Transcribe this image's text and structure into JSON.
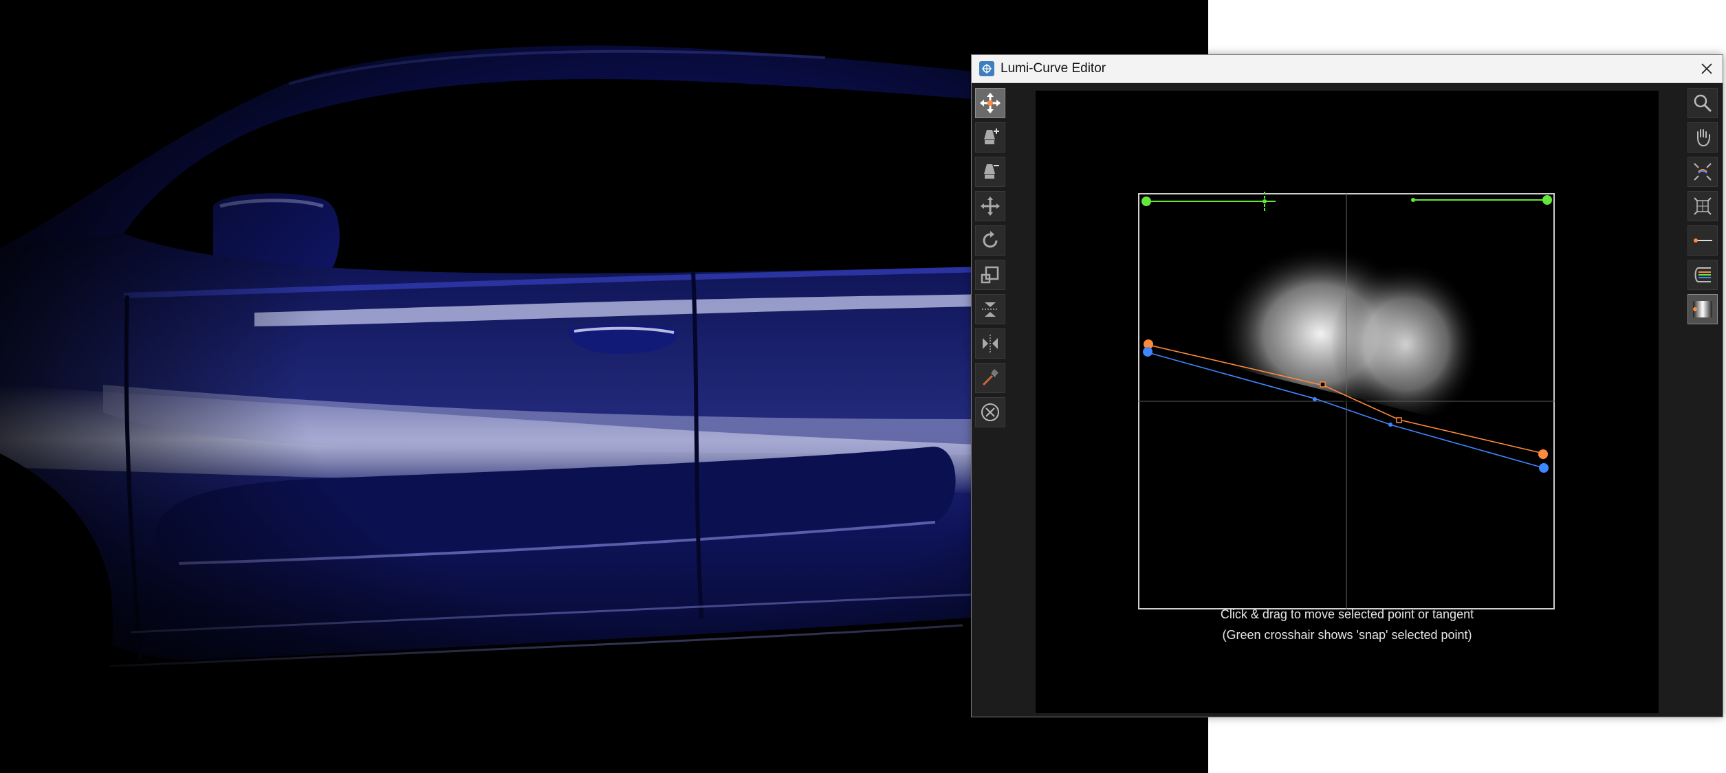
{
  "window": {
    "title": "Lumi-Curve Editor",
    "app_icon": "lumi-curve-app-icon",
    "close_icon": "close-icon"
  },
  "left_toolbar": [
    {
      "name": "move-point-tool",
      "icon": "move-arrows-icon",
      "active": true
    },
    {
      "name": "add-point-tool",
      "icon": "pen-plus-icon",
      "active": false
    },
    {
      "name": "remove-point-tool",
      "icon": "pen-minus-icon",
      "active": false
    },
    {
      "name": "move-all-tool",
      "icon": "move-cross-icon",
      "active": false
    },
    {
      "name": "rotate-tool",
      "icon": "rotate-icon",
      "active": false
    },
    {
      "name": "scale-tool",
      "icon": "scale-box-icon",
      "active": false
    },
    {
      "name": "flip-vertical-tool",
      "icon": "flip-vertical-icon",
      "active": false
    },
    {
      "name": "mirror-horizontal-tool",
      "icon": "mirror-horizontal-icon",
      "active": false
    },
    {
      "name": "eyedropper-tool",
      "icon": "eyedropper-icon",
      "active": false
    },
    {
      "name": "reset-tool",
      "icon": "circle-x-icon",
      "active": false
    }
  ],
  "right_toolbar": [
    {
      "name": "zoom-tool",
      "icon": "magnifier-icon",
      "active": false
    },
    {
      "name": "pan-tool",
      "icon": "hand-icon",
      "active": false
    },
    {
      "name": "fit-view-tool",
      "icon": "fit-arrows-icon",
      "active": false
    },
    {
      "name": "frame-all-tool",
      "icon": "frame-grid-icon",
      "active": false
    },
    {
      "name": "show-curve-tool",
      "icon": "curve-line-icon",
      "active": false
    },
    {
      "name": "gradient-lines-tool",
      "icon": "gradient-lines-icon",
      "active": false
    },
    {
      "name": "falloff-preview-tool",
      "icon": "falloff-preview-icon",
      "active": true
    }
  ],
  "hints": {
    "line1": "Click & drag to move selected point or tangent",
    "line2": "(Green crosshair shows 'snap' selected point)"
  },
  "colors": {
    "orange_curve": "#ff8a3d",
    "blue_curve": "#3f86ff",
    "green_handles": "#63e83a",
    "car_paint": "#141a6b"
  }
}
